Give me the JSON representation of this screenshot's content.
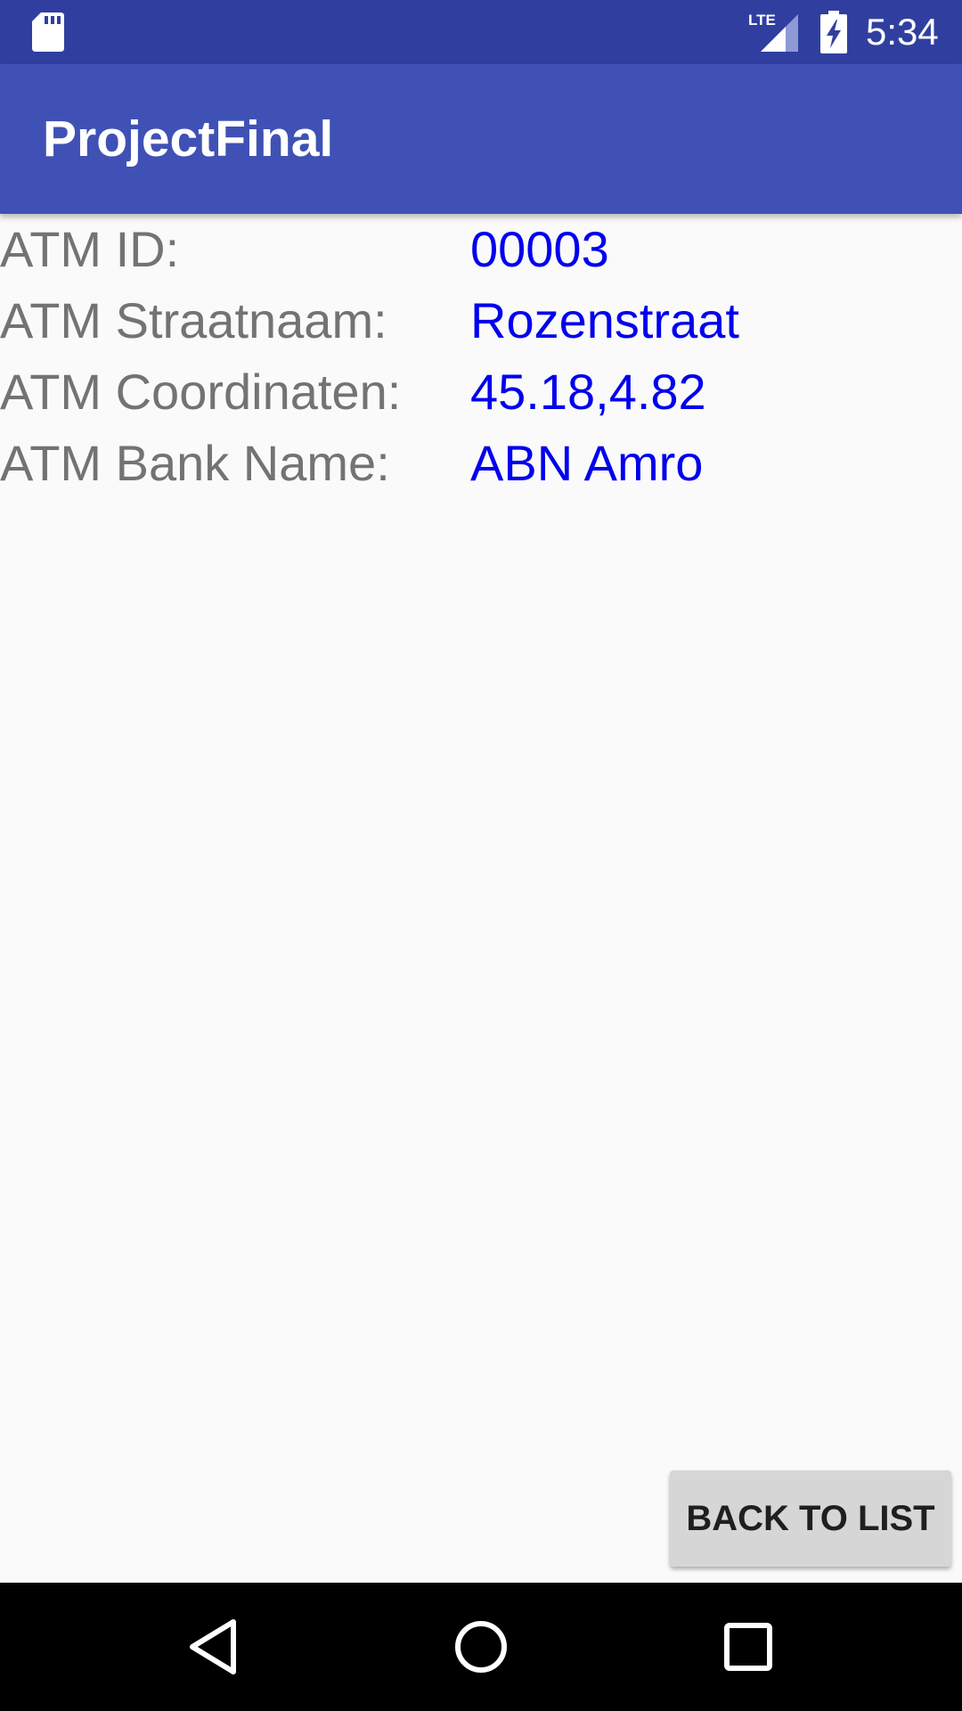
{
  "status_bar": {
    "time": "5:34",
    "network": "LTE",
    "icons": [
      "sd-card-icon",
      "lte-signal-icon",
      "battery-charging-icon"
    ]
  },
  "app_bar": {
    "title": "ProjectFinal"
  },
  "atm": {
    "rows": [
      {
        "label": "ATM ID:",
        "value": "00003"
      },
      {
        "label": "ATM Straatnaam:",
        "value": "Rozenstraat"
      },
      {
        "label": "ATM Coordinaten:",
        "value": "45.18,4.82"
      },
      {
        "label": "ATM Bank Name:",
        "value": "ABN Amro"
      }
    ]
  },
  "actions": {
    "back_label": "BACK TO LIST"
  },
  "nav_bar": {
    "icons": [
      "back-icon",
      "home-icon",
      "recents-icon"
    ]
  },
  "colors": {
    "status_bar": "#303f9f",
    "app_bar": "#3f51b5",
    "label_text": "#737373",
    "value_text": "#0000ee",
    "button_bg": "#d6d6d6"
  }
}
